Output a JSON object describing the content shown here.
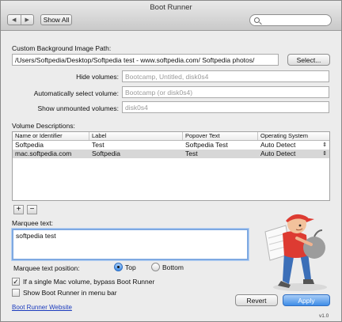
{
  "window": {
    "title": "Boot Runner"
  },
  "toolbar": {
    "back_glyph": "◀",
    "forward_glyph": "▶",
    "show_all_label": "Show All",
    "search_value": ""
  },
  "background": {
    "label": "Custom Background Image Path:",
    "path": "/Users/Softpedia/Desktop/Softpedia test - www.softpedia.com/ Softpedia photos/",
    "select_label": "Select..."
  },
  "hide_volumes": {
    "label": "Hide volumes:",
    "placeholder": "Bootcamp, Untitled, disk0s4"
  },
  "auto_select": {
    "label": "Automatically select volume:",
    "placeholder": "Bootcamp (or disk0s4)"
  },
  "show_unmounted": {
    "label": "Show unmounted volumes:",
    "placeholder": "disk0s4"
  },
  "volume_descriptions": {
    "label": "Volume Descriptions:",
    "columns": [
      "Name or Identifier",
      "Label",
      "Popover Text",
      "Operating System"
    ],
    "rows": [
      {
        "name": "Softpedia",
        "label": "Test",
        "popover": "Softpedia Test",
        "os": "Auto Detect"
      },
      {
        "name": "mac.softpedia.com",
        "label": "Softpedia",
        "popover": "Test",
        "os": "Auto Detect"
      }
    ],
    "add_label": "+",
    "remove_label": "−",
    "stepper_glyph": "⇕"
  },
  "marquee": {
    "label": "Marquee text:",
    "value": "softpedia test",
    "position_label": "Marquee text position:",
    "top_label": "Top",
    "bottom_label": "Bottom",
    "selected": "Top"
  },
  "options": {
    "bypass_label": "If a single Mac volume, bypass Boot Runner",
    "bypass_checked": true,
    "menubar_label": "Show Boot Runner in menu bar",
    "menubar_checked": false,
    "check_glyph": "✓"
  },
  "footer": {
    "website_label": "Boot Runner Website",
    "revert_label": "Revert",
    "apply_label": "Apply",
    "version": "v1.0"
  },
  "colors": {
    "accent": "#3e8de7",
    "link": "#1b3bbd",
    "selected_row": "#d7d7d7"
  }
}
